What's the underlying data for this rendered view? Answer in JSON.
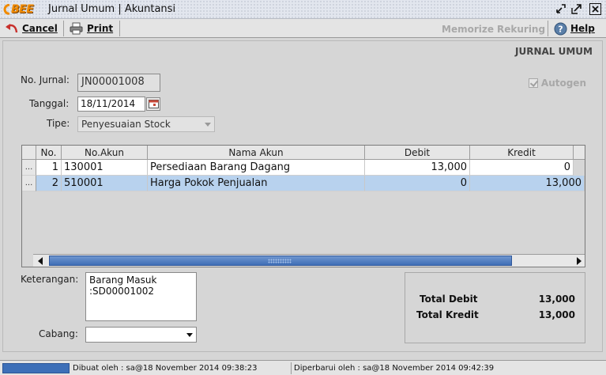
{
  "window": {
    "logo_text": "BEE",
    "title": "Jurnal Umum | Akuntansi"
  },
  "toolbar": {
    "cancel_label": "Cancel",
    "print_label": "Print",
    "memorize_label": "Memorize",
    "rekuring_label": "Rekuring",
    "help_label": "Help"
  },
  "form": {
    "section_title": "JURNAL UMUM",
    "no_jurnal_label": "No. Jurnal:",
    "no_jurnal_value": "JN00001008",
    "tanggal_label": "Tanggal:",
    "tanggal_value": "18/11/2014",
    "tipe_label": "Tipe:",
    "tipe_value": "Penyesuaian Stock",
    "autogen_label": "Autogen",
    "autogen_checked": true
  },
  "table": {
    "headers": [
      "No.",
      "No.Akun",
      "Nama Akun",
      "Debit",
      "Kredit"
    ],
    "rows": [
      {
        "btn": "...",
        "no": "1",
        "akun": "130001",
        "nama": "Persediaan Barang Dagang",
        "debit": "13,000",
        "kredit": "0",
        "selected": false
      },
      {
        "btn": "...",
        "no": "2",
        "akun": "510001",
        "nama": "Harga Pokok Penjualan",
        "debit": "0",
        "kredit": "13,000",
        "selected": true
      }
    ]
  },
  "notes": {
    "keterangan_label": "Keterangan:",
    "keterangan_lines": [
      "Barang Masuk",
      ":SD00001002"
    ],
    "cabang_label": "Cabang:",
    "cabang_value": ""
  },
  "totals": {
    "debit_label": "Total Debit",
    "debit_value": "13,000",
    "kredit_label": "Total Kredit",
    "kredit_value": "13,000"
  },
  "status": {
    "created": "Dibuat oleh : sa@18 November 2014  09:38:23",
    "updated": "Diperbarui oleh : sa@18 November 2014  09:42:39"
  },
  "colors": {
    "selection": "#b8d2ee",
    "scroll_thumb": "#3f6eb6",
    "logo": "#f08a00"
  }
}
